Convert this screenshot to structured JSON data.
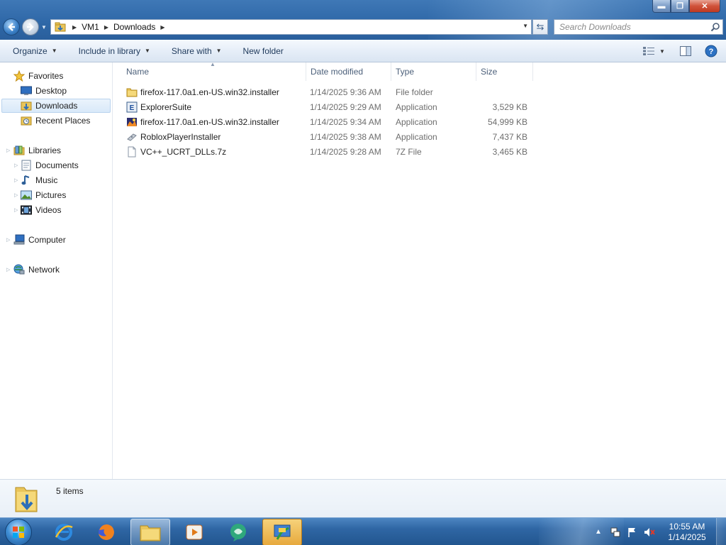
{
  "window": {
    "controls": {
      "minimize": "▬",
      "maximize": "❐",
      "close": "✕"
    }
  },
  "address": {
    "breadcrumbs": [
      "VM1",
      "Downloads"
    ]
  },
  "search": {
    "placeholder": "Search Downloads"
  },
  "commandbar": {
    "organize": "Organize",
    "include_in_library": "Include in library",
    "share_with": "Share with",
    "new_folder": "New folder"
  },
  "navpane": {
    "favorites": {
      "label": "Favorites",
      "items": [
        {
          "label": "Desktop",
          "icon": "desktop-icon"
        },
        {
          "label": "Downloads",
          "icon": "downloads-folder-icon",
          "selected": true
        },
        {
          "label": "Recent Places",
          "icon": "recent-places-icon"
        }
      ]
    },
    "libraries": {
      "label": "Libraries",
      "items": [
        {
          "label": "Documents",
          "icon": "documents-icon"
        },
        {
          "label": "Music",
          "icon": "music-icon"
        },
        {
          "label": "Pictures",
          "icon": "pictures-icon"
        },
        {
          "label": "Videos",
          "icon": "videos-icon"
        }
      ]
    },
    "computer": {
      "label": "Computer"
    },
    "network": {
      "label": "Network"
    }
  },
  "columns": {
    "name": "Name",
    "date": "Date modified",
    "type": "Type",
    "size": "Size"
  },
  "files": [
    {
      "name": "firefox-117.0a1.en-US.win32.installer",
      "date": "1/14/2025 9:36 AM",
      "type": "File folder",
      "size": "",
      "icon": "folder-icon"
    },
    {
      "name": "ExplorerSuite",
      "date": "1/14/2025 9:29 AM",
      "type": "Application",
      "size": "3,529 KB",
      "icon": "explorersuite-icon"
    },
    {
      "name": "firefox-117.0a1.en-US.win32.installer",
      "date": "1/14/2025 9:34 AM",
      "type": "Application",
      "size": "54,999 KB",
      "icon": "firefox-installer-icon"
    },
    {
      "name": "RobloxPlayerInstaller",
      "date": "1/14/2025 9:38 AM",
      "type": "Application",
      "size": "7,437 KB",
      "icon": "roblox-icon"
    },
    {
      "name": "VC++_UCRT_DLLs.7z",
      "date": "1/14/2025 9:28 AM",
      "type": "7Z File",
      "size": "3,465 KB",
      "icon": "generic-file-icon"
    }
  ],
  "status": {
    "items_count": "5 items"
  },
  "taskbar": {
    "clock_time": "10:55 AM",
    "clock_date": "1/14/2025",
    "pinned": [
      "start-orb-icon",
      "internet-explorer-icon",
      "firefox-icon",
      "windows-explorer-icon",
      "media-player-icon",
      "messenger-icon",
      "control-panel-icon"
    ]
  },
  "colors": {
    "titlebar": "#2f68a8",
    "taskbar": "#2f66a4",
    "selection": "#d9e9f9",
    "link_text": "#1e395b"
  }
}
